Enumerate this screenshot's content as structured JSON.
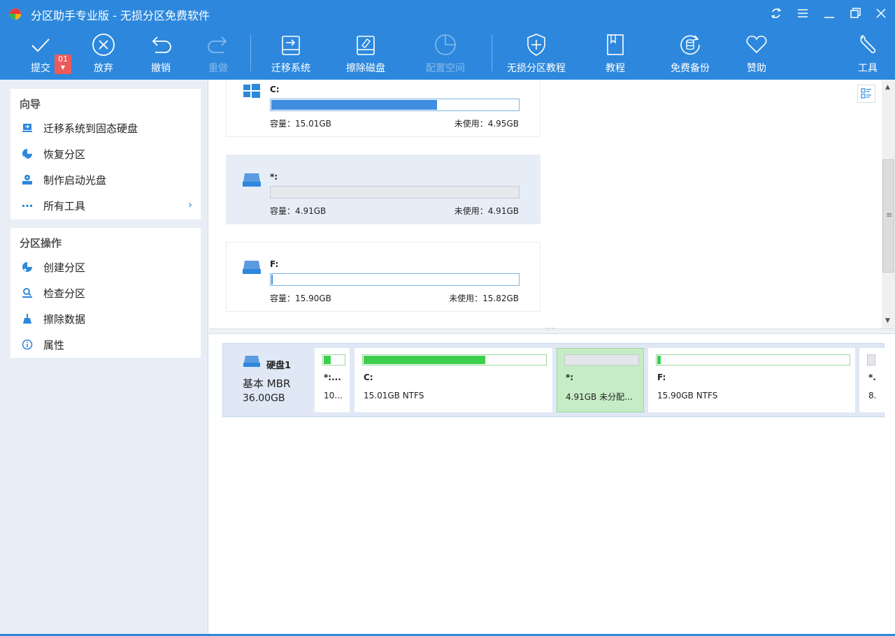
{
  "window": {
    "title": "分区助手专业版 - 无损分区免费软件",
    "controls": [
      "refresh-icon",
      "menu-icon",
      "minimize-icon",
      "restore-icon",
      "close-icon"
    ]
  },
  "toolbar": {
    "pending_badge": "01",
    "items": [
      {
        "label": "提交",
        "icon": "check-icon",
        "enabled": true
      },
      {
        "label": "放弃",
        "icon": "circle-x-icon",
        "enabled": true
      },
      {
        "label": "撤销",
        "icon": "undo-icon",
        "enabled": true
      },
      {
        "label": "重做",
        "icon": "redo-icon",
        "enabled": false
      },
      {
        "label": "迁移系统",
        "icon": "migrate-os-icon",
        "enabled": true
      },
      {
        "label": "擦除磁盘",
        "icon": "wipe-disk-icon",
        "enabled": true
      },
      {
        "label": "配置空间",
        "icon": "allocate-space-icon",
        "enabled": false
      },
      {
        "label": "无损分区教程",
        "icon": "shield-plus-icon",
        "enabled": true
      },
      {
        "label": "教程",
        "icon": "book-icon",
        "enabled": true
      },
      {
        "label": "免费备份",
        "icon": "backup-icon",
        "enabled": true
      },
      {
        "label": "赞助",
        "icon": "heart-icon",
        "enabled": true
      },
      {
        "label": "工具",
        "icon": "wrench-icon",
        "enabled": true
      }
    ]
  },
  "sidebar": {
    "wizard": {
      "title": "向导",
      "items": [
        {
          "label": "迁移系统到固态硬盘",
          "icon": "migrate-ssd-icon"
        },
        {
          "label": "恢复分区",
          "icon": "recover-partition-icon"
        },
        {
          "label": "制作启动光盘",
          "icon": "bootable-media-icon"
        },
        {
          "label": "所有工具",
          "icon": "more-dots-icon",
          "has_submenu": true
        }
      ]
    },
    "operations": {
      "title": "分区操作",
      "items": [
        {
          "label": "创建分区",
          "icon": "create-partition-icon"
        },
        {
          "label": "检查分区",
          "icon": "check-partition-icon"
        },
        {
          "label": "擦除数据",
          "icon": "wipe-data-icon"
        },
        {
          "label": "属性",
          "icon": "info-icon"
        }
      ]
    }
  },
  "cards": [
    {
      "name": "C:",
      "icon": "windows-drive-icon",
      "capacity_label": "容量：15.01GB",
      "free_label": "未使用：4.95GB",
      "used_fraction": 0.67,
      "unallocated": false,
      "selected": false
    },
    {
      "name": "*:",
      "icon": "drive-icon",
      "capacity_label": "容量：4.91GB",
      "free_label": "未使用：4.91GB",
      "used_fraction": 0.0,
      "unallocated": true,
      "selected": true
    },
    {
      "name": "F:",
      "icon": "drive-icon",
      "capacity_label": "容量：15.90GB",
      "free_label": "未使用：15.82GB",
      "used_fraction": 0.005,
      "unallocated": false,
      "selected": false
    }
  ],
  "disk": {
    "name": "硬盘1",
    "type": "基本 MBR",
    "size": "36.00GB",
    "partitions": [
      {
        "name": "*:...",
        "desc": "10...",
        "used_fraction": 0.35,
        "unallocated": false,
        "selected": false
      },
      {
        "name": "C:",
        "desc": "15.01GB NTFS",
        "used_fraction": 0.67,
        "unallocated": false,
        "selected": false
      },
      {
        "name": "*:",
        "desc": "4.91GB 未分配...",
        "used_fraction": 0.0,
        "unallocated": true,
        "selected": true
      },
      {
        "name": "F:",
        "desc": "15.90GB NTFS",
        "used_fraction": 0.02,
        "unallocated": false,
        "selected": false
      },
      {
        "name": "*.",
        "desc": "8.",
        "used_fraction": 0.0,
        "unallocated": true,
        "selected": false
      }
    ]
  },
  "colors": {
    "accent": "#2d88dd",
    "used_bar": "#3f8ee0",
    "disk_used": "#3ccf4e",
    "selected_green": "#c6ecc6",
    "badge": "#ec5a5a"
  }
}
